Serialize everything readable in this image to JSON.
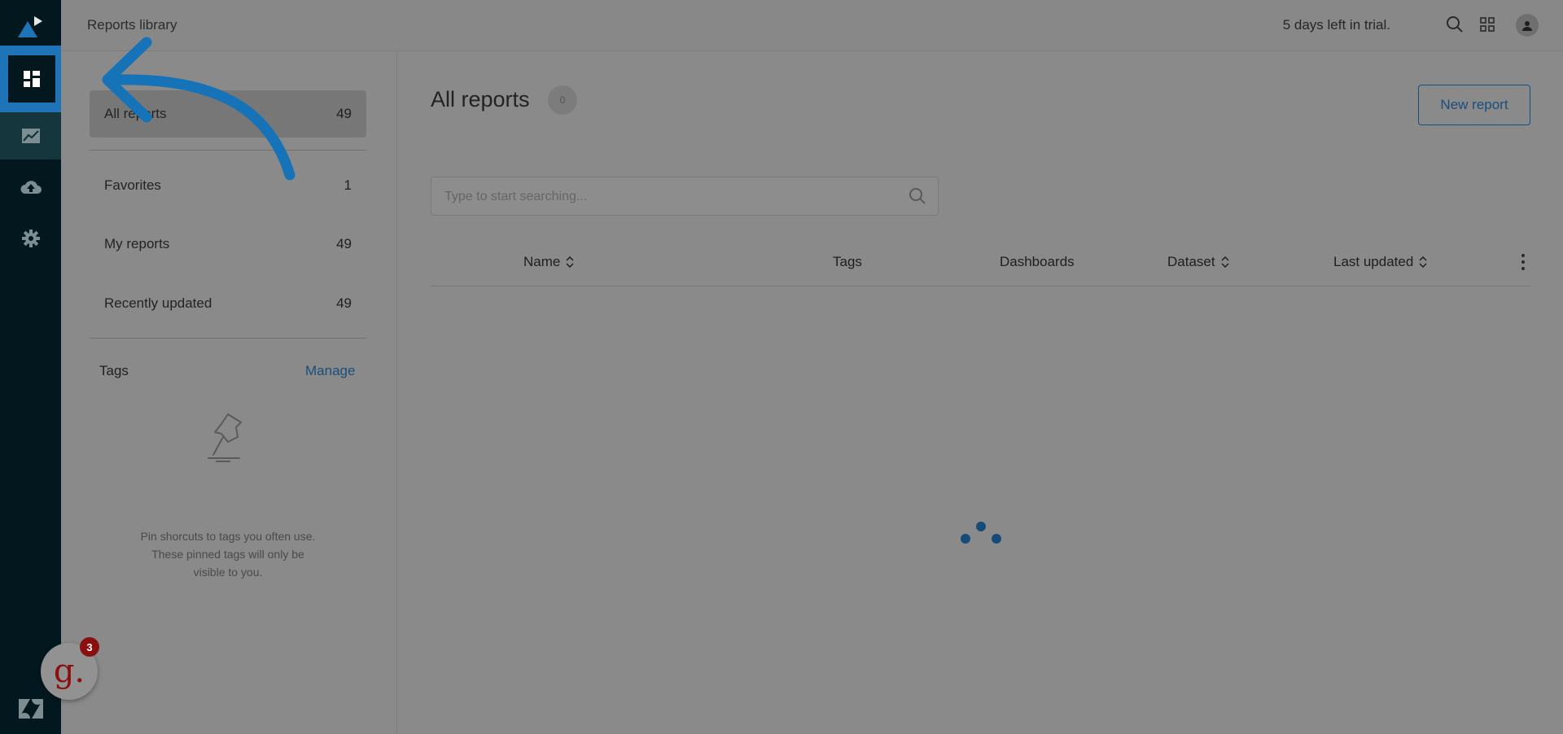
{
  "header": {
    "breadcrumb": "Reports library",
    "trial_text": "5 days left in trial.",
    "icons": [
      "search-icon",
      "product-tray-icon",
      "user-avatar-icon"
    ]
  },
  "rail": {
    "icons": [
      "explore-logo-icon",
      "dashboard-icon",
      "reports-chart-icon",
      "upload-cloud-icon",
      "settings-gear-icon",
      "zendesk-logo-icon"
    ],
    "accent": "#1f73b7"
  },
  "sidebar": {
    "items": [
      {
        "label": "All reports",
        "count": "49"
      },
      {
        "label": "Favorites",
        "count": "1"
      },
      {
        "label": "My reports",
        "count": "49"
      },
      {
        "label": "Recently updated",
        "count": "49"
      }
    ],
    "tags_title": "Tags",
    "manage_label": "Manage",
    "empty_line1": "Pin shorcuts to tags you often use.",
    "empty_line2": "These pinned tags will only be",
    "empty_line3": "visible to you."
  },
  "main": {
    "title": "All reports",
    "count_badge": "0",
    "new_report_label": "New report",
    "search_placeholder": "Type to start searching...",
    "columns": [
      {
        "label": "Name",
        "sortable": true
      },
      {
        "label": "Tags",
        "sortable": false
      },
      {
        "label": "Dashboards",
        "sortable": false
      },
      {
        "label": "Dataset",
        "sortable": true
      },
      {
        "label": "Last updated",
        "sortable": true
      }
    ]
  },
  "widget": {
    "letter": "g.",
    "badge": "3",
    "color": "#8a1010"
  }
}
